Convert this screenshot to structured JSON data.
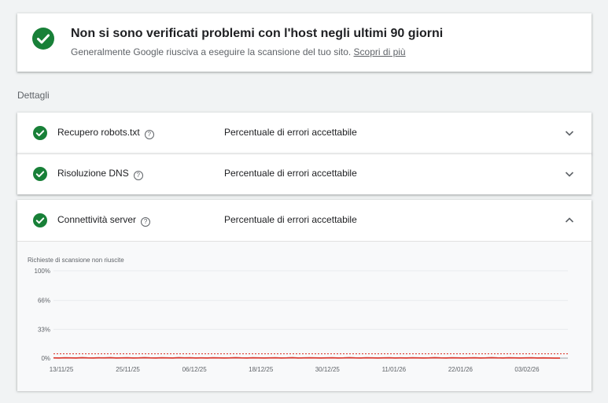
{
  "status": {
    "title": "Non si sono verificati problemi con l'host negli ultimi 90 giorni",
    "subtitle": "Generalmente Google riusciva a eseguire la scansione del tuo sito.",
    "link": "Scopri di più",
    "icon": "check-circle-icon",
    "color": "#188038"
  },
  "details_label": "Dettagli",
  "rows": [
    {
      "name": "Recupero robots.txt",
      "status": "Percentuale di errori accettabile",
      "expanded": false
    },
    {
      "name": "Risoluzione DNS",
      "status": "Percentuale di errori accettabile",
      "expanded": false
    },
    {
      "name": "Connettività server",
      "status": "Percentuale di errori accettabile",
      "expanded": true
    }
  ],
  "help_glyph": "?",
  "chart_data": {
    "type": "line",
    "title": "Richieste di scansione non riuscite",
    "ylim": [
      0,
      100
    ],
    "y_ticks": [
      "100%",
      "66%",
      "33%",
      "0%"
    ],
    "y_tick_values": [
      100,
      66,
      33,
      0
    ],
    "x_ticks": [
      "13/11/25",
      "25/11/25",
      "06/12/25",
      "18/12/25",
      "30/12/25",
      "11/01/26",
      "22/01/26",
      "03/02/26"
    ],
    "threshold": 5,
    "grid": true,
    "series": [
      {
        "values": [
          0.3,
          0.2,
          0.4,
          0.3,
          0.2,
          0.5,
          0.3,
          0.2,
          0.4,
          0.3,
          0.5,
          0.2,
          0.3,
          0.4,
          0.2,
          0.3,
          0.5,
          0.3,
          0.2,
          0.4,
          0.3,
          0.2,
          0.5,
          0.3,
          0.4,
          0.2,
          0.3,
          0.2,
          0.4,
          0.3,
          0.2,
          0.3,
          0.5,
          0.3,
          0.2,
          0.4,
          0.3,
          0.2,
          0.3,
          0.4,
          0.2,
          0.3,
          0.5,
          0.2,
          0.3,
          0.4,
          0.3,
          0.2,
          0.3,
          0.4,
          0.2,
          0.3,
          0.5,
          0.3,
          0.2,
          0.4,
          0.3,
          0.2,
          0.3,
          0.4,
          0.2,
          0.3,
          0.2,
          0.4,
          0.3,
          0.2,
          0.3,
          0.5,
          0.3,
          0.2,
          0.4,
          0.3,
          0.2,
          0.3,
          0.4,
          0.2,
          0.3,
          0.5,
          0.3,
          0.2,
          0.4,
          0.3,
          0.2,
          0.3,
          0.4,
          0.2,
          0.3,
          0.2,
          0.1,
          0.1
        ],
        "color": "#d93025"
      }
    ],
    "threshold_color": "#d93025"
  }
}
